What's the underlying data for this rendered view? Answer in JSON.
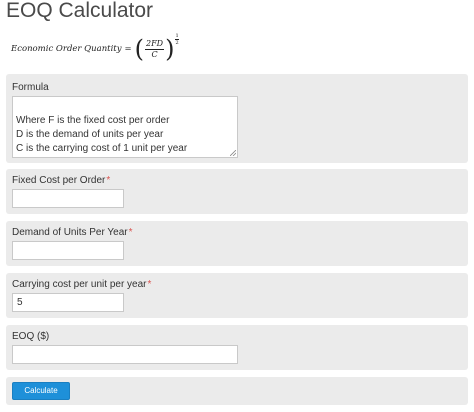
{
  "title": "EOQ Calculator",
  "formula_display": {
    "lhs": "Economic Order Quantity",
    "equals": "=",
    "open_paren": "(",
    "close_paren": ")",
    "numerator": "2FD",
    "denominator": "C",
    "exponent_numerator": "1",
    "exponent_denominator": "2"
  },
  "formula_panel": {
    "label": "Formula",
    "text": "Where F is the fixed cost per order\nD is the demand of units per year\nC is the carrying cost of 1 unit per year"
  },
  "fields": {
    "fixed_cost": {
      "label": "Fixed Cost per Order",
      "required_mark": "*",
      "value": ""
    },
    "demand": {
      "label": "Demand of Units Per Year",
      "required_mark": "*",
      "value": ""
    },
    "carrying_cost": {
      "label": "Carrying cost per unit per year",
      "required_mark": "*",
      "value": "5"
    },
    "eoq": {
      "label": "EOQ ($)",
      "value": ""
    }
  },
  "calculate_button": {
    "label": "Calculate"
  },
  "colors": {
    "panel_bg": "#ebebeb",
    "button_bg": "#1e90d9",
    "required_mark": "#d9534f"
  }
}
